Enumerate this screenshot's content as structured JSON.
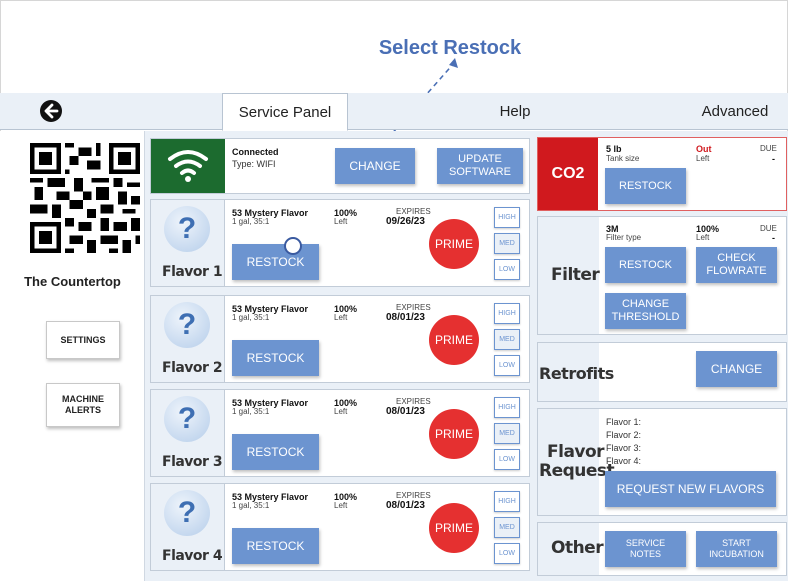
{
  "annotation": {
    "title": "Select Restock"
  },
  "tabs": {
    "service_panel": "Service Panel",
    "help": "Help",
    "advanced": "Advanced"
  },
  "sidebar": {
    "brand": "The Countertop",
    "settings": "SETTINGS",
    "machine_alerts_1": "MACHINE",
    "machine_alerts_2": "ALERTS"
  },
  "connection": {
    "status": "Connected",
    "type": "Type: WIFI",
    "change": "CHANGE",
    "update_1": "UPDATE",
    "update_2": "SOFTWARE"
  },
  "flavors": [
    {
      "label": "Flavor 1",
      "name": "53 Mystery Flavor",
      "ratio": "1 gal, 35:1",
      "pct": "100%",
      "left": "Left",
      "expires_label": "EXPIRES",
      "expires": "09/26/23",
      "restock": "RESTOCK",
      "prime": "PRIME",
      "high": "HIGH",
      "med": "MED",
      "low": "LOW"
    },
    {
      "label": "Flavor 2",
      "name": "53 Mystery Flavor",
      "ratio": "1 gal, 35:1",
      "pct": "100%",
      "left": "Left",
      "expires_label": "EXPIRES",
      "expires": "08/01/23",
      "restock": "RESTOCK",
      "prime": "PRIME",
      "high": "HIGH",
      "med": "MED",
      "low": "LOW"
    },
    {
      "label": "Flavor 3",
      "name": "53 Mystery Flavor",
      "ratio": "1 gal, 35:1",
      "pct": "100%",
      "left": "Left",
      "expires_label": "EXPIRES",
      "expires": "08/01/23",
      "restock": "RESTOCK",
      "prime": "PRIME",
      "high": "HIGH",
      "med": "MED",
      "low": "LOW"
    },
    {
      "label": "Flavor 4",
      "name": "53 Mystery Flavor",
      "ratio": "1 gal, 35:1",
      "pct": "100%",
      "left": "Left",
      "expires_label": "EXPIRES",
      "expires": "08/01/23",
      "restock": "RESTOCK",
      "prime": "PRIME",
      "high": "HIGH",
      "med": "MED",
      "low": "LOW"
    }
  ],
  "co2": {
    "label": "CO2",
    "size": "5 lb",
    "size_sub": "Tank size",
    "status": "Out",
    "status_sub": "Left",
    "due": "DUE",
    "due_val": "-",
    "restock": "RESTOCK"
  },
  "filter": {
    "label": "Filter",
    "type": "3M",
    "type_sub": "Filter type",
    "pct": "100%",
    "pct_sub": "Left",
    "due": "DUE",
    "due_val": "-",
    "restock": "RESTOCK",
    "check_1": "CHECK",
    "check_2": "FLOWRATE",
    "thresh_1": "CHANGE",
    "thresh_2": "THRESHOLD"
  },
  "retrofits": {
    "label": "Retrofits",
    "change": "CHANGE"
  },
  "flavor_request": {
    "label_1": "Flavor",
    "label_2": "Request",
    "f1": "Flavor 1:",
    "f2": "Flavor 2:",
    "f3": "Flavor 3:",
    "f4": "Flavor 4:",
    "button": "REQUEST NEW FLAVORS"
  },
  "other": {
    "label": "Other",
    "notes_1": "SERVICE",
    "notes_2": "NOTES",
    "incub_1": "START",
    "incub_2": "INCUBATION"
  },
  "colors": {
    "accent": "#6c94d0",
    "prime": "#e53030",
    "co2": "#d0191e",
    "wifi": "#1c6b2f",
    "annotation": "#4a6fb5"
  },
  "icons": [
    "back-arrow-icon",
    "qr-code",
    "wifi-icon",
    "question-mark-icon"
  ]
}
